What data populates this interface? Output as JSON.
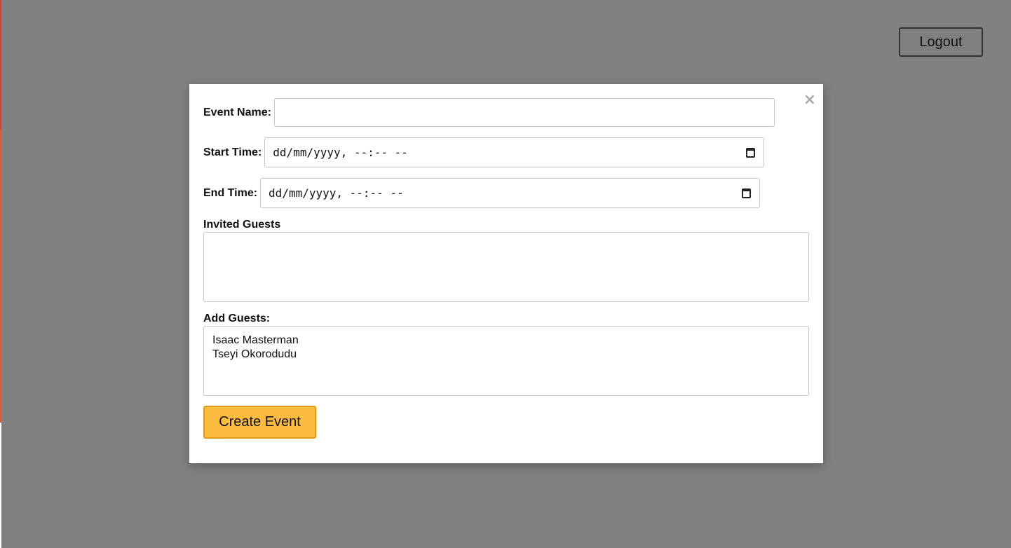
{
  "header": {
    "logout_label": "Logout"
  },
  "modal": {
    "close_glyph": "×",
    "event_name": {
      "label": "Event Name:",
      "value": ""
    },
    "start_time": {
      "label": "Start Time:",
      "value": "dd/mm/yyyy, --:-- --"
    },
    "end_time": {
      "label": "End Time:",
      "value": "dd/mm/yyyy, --:-- --"
    },
    "invited_guests": {
      "label": "Invited Guests",
      "items": []
    },
    "add_guests": {
      "label": "Add Guests:",
      "items": [
        "Isaac Masterman",
        "Tseyi Okorodudu"
      ]
    },
    "create_label": "Create Event"
  },
  "icons": {
    "close": "close-icon",
    "calendar": "calendar-icon"
  },
  "colors": {
    "overlay": "#808080",
    "create_button_bg": "#fbbb3f",
    "create_button_border": "#e09a1a",
    "background_accent": "#d2403a"
  }
}
